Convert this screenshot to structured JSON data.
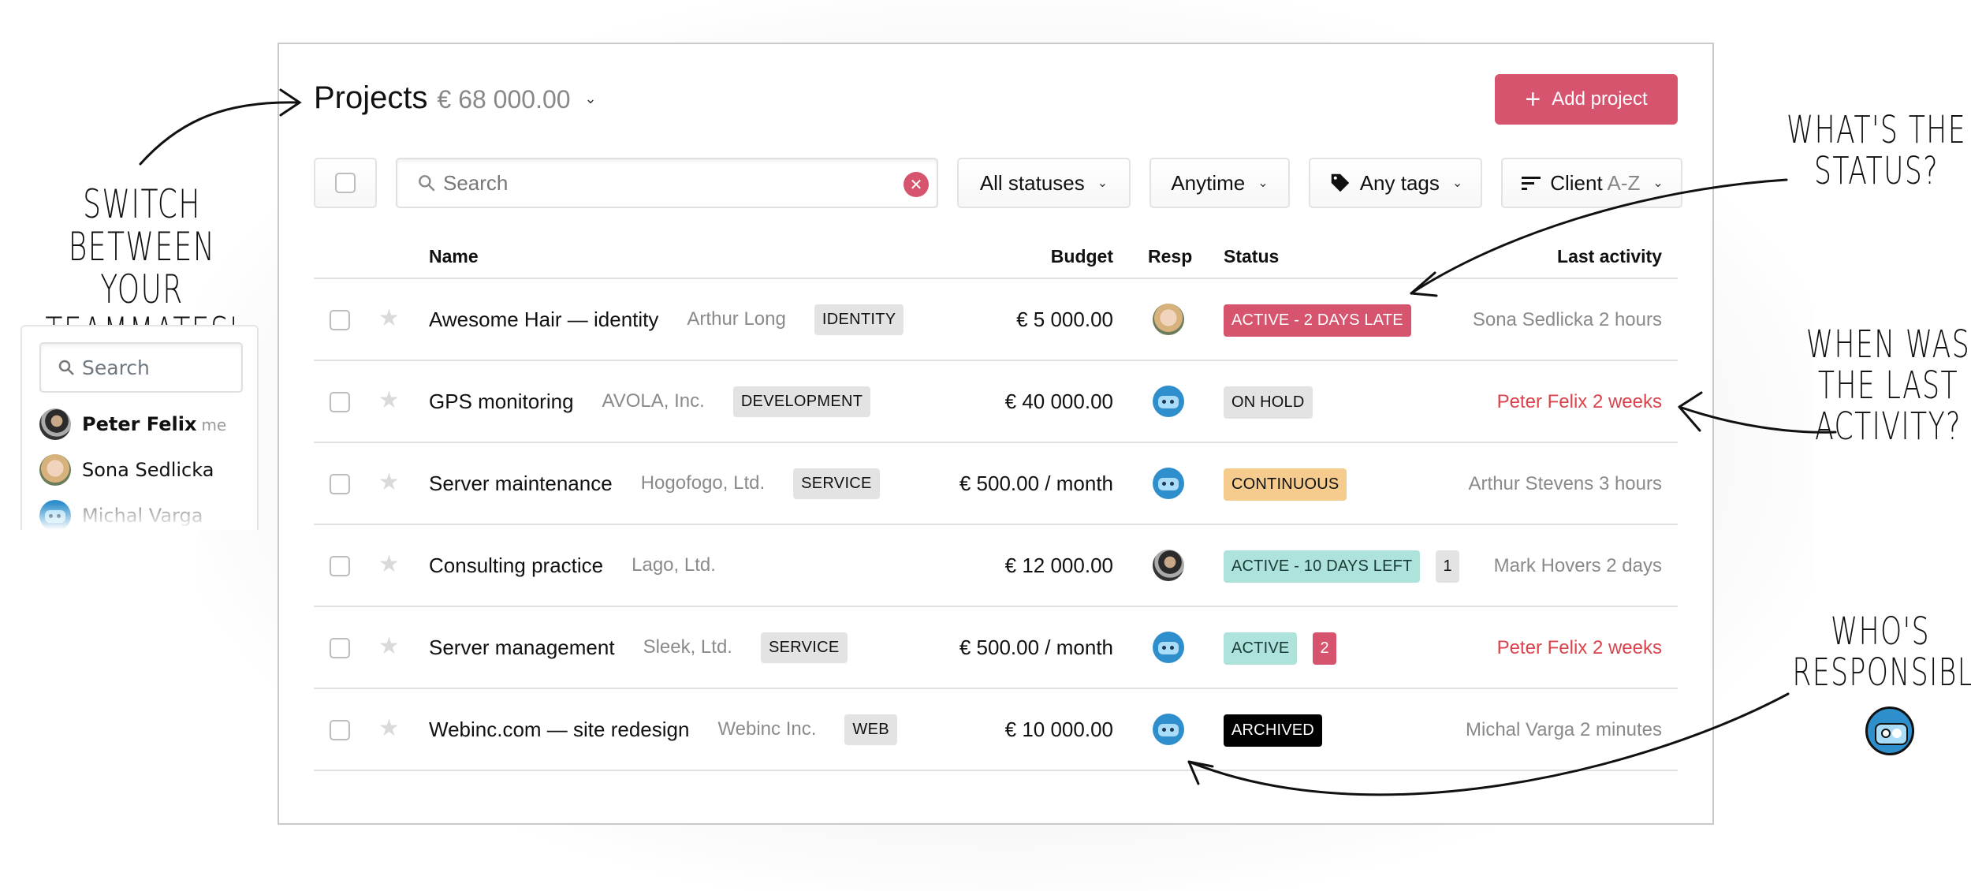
{
  "header": {
    "title": "Projects",
    "total": "€ 68 000.00",
    "add_button": "Add project"
  },
  "filters": {
    "search_placeholder": "Search",
    "status": "All statuses",
    "time": "Anytime",
    "tags": "Any tags",
    "sort_label": "Client",
    "sort_order": "A-Z"
  },
  "columns": {
    "name": "Name",
    "budget": "Budget",
    "resp": "Resp",
    "status": "Status",
    "last": "Last activity"
  },
  "rows": [
    {
      "name": "Awesome Hair — identity",
      "client": "Arthur Long",
      "tag": "IDENTITY",
      "budget": "€ 5 000.00",
      "resp": "Sona Sedlicka",
      "status": "ACTIVE - 2 DAYS LATE",
      "status_kind": "late",
      "count": null,
      "last": "Sona Sedlicka 2 hours",
      "last_alert": false
    },
    {
      "name": "GPS monitoring",
      "client": "AVOLA, Inc.",
      "tag": "DEVELOPMENT",
      "budget": "€ 40 000.00",
      "resp": "Michal Varga",
      "status": "ON HOLD",
      "status_kind": "hold",
      "count": null,
      "last": "Peter Felix 2 weeks",
      "last_alert": true
    },
    {
      "name": "Server maintenance",
      "client": "Hogofogo, Ltd.",
      "tag": "SERVICE",
      "budget": "€ 500.00 / month",
      "resp": "Michal Varga",
      "status": "CONTINUOUS",
      "status_kind": "cont",
      "count": null,
      "last": "Arthur Stevens 3 hours",
      "last_alert": false
    },
    {
      "name": "Consulting practice",
      "client": "Lago, Ltd.",
      "tag": null,
      "budget": "€ 12 000.00",
      "resp": "Peter Felix",
      "status": "ACTIVE - 10 DAYS LEFT",
      "status_kind": "active",
      "count": "1",
      "count_kind": "gray",
      "last": "Mark Hovers 2 days",
      "last_alert": false
    },
    {
      "name": "Server management",
      "client": "Sleek, Ltd.",
      "tag": "SERVICE",
      "budget": "€ 500.00 / month",
      "resp": "Michal Varga",
      "status": "ACTIVE",
      "status_kind": "active",
      "count": "2",
      "count_kind": "red",
      "last": "Peter Felix 2 weeks",
      "last_alert": true
    },
    {
      "name": "Webinc.com — site redesign",
      "client": "Webinc Inc.",
      "tag": "WEB",
      "budget": "€ 10 000.00",
      "resp": "Michal Varga",
      "status": "ARCHIVED",
      "status_kind": "archived",
      "count": null,
      "last": "Michal Varga 2 minutes",
      "last_alert": false
    }
  ],
  "team_panel": {
    "search_placeholder": "Search",
    "members": [
      {
        "name": "Peter Felix",
        "suffix": "me"
      },
      {
        "name": "Sona Sedlicka",
        "suffix": ""
      },
      {
        "name": "Michal Varga",
        "suffix": ""
      }
    ]
  },
  "annotations": {
    "switch": "SWITCH BETWEEN YOUR TEAMMATES' PROJECTS",
    "status": "WHAT'S THE STATUS?",
    "activity": "WHEN WAS THE LAST ACTIVITY?",
    "responsible": "WHO'S RESPONSIBLE?"
  },
  "colors": {
    "accent": "#d6546e",
    "alert_text": "#d9434b",
    "active": "#aee3dc",
    "continuous": "#f5cc8d",
    "archived": "#000000"
  }
}
